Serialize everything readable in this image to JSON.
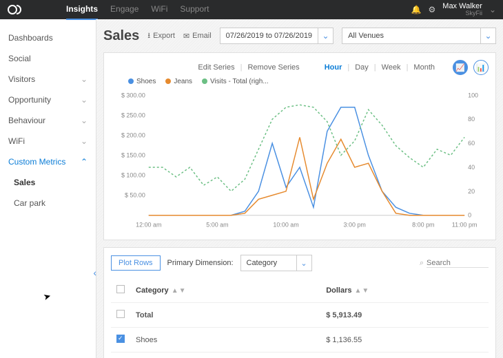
{
  "top": {
    "nav": [
      "Insights",
      "Engage",
      "WiFi",
      "Support"
    ],
    "active_index": 0,
    "user_name": "Max Walker",
    "user_org": "SkyFii"
  },
  "sidebar": {
    "items": [
      {
        "label": "Dashboards",
        "expandable": false
      },
      {
        "label": "Social",
        "expandable": false
      },
      {
        "label": "Visitors",
        "expandable": true
      },
      {
        "label": "Opportunity",
        "expandable": true
      },
      {
        "label": "Behaviour",
        "expandable": true
      },
      {
        "label": "WiFi",
        "expandable": true
      },
      {
        "label": "Custom Metrics",
        "expandable": true,
        "expanded": true,
        "active": true
      }
    ],
    "children": [
      {
        "label": "Sales",
        "active": true
      },
      {
        "label": "Car park",
        "active": false
      }
    ]
  },
  "page": {
    "title": "Sales",
    "export": "Export",
    "email": "Email",
    "date_range": "07/26/2019 to 07/26/2019",
    "venue": "All Venues"
  },
  "chart_controls": {
    "edit": "Edit Series",
    "remove": "Remove Series",
    "granularity": [
      "Hour",
      "Day",
      "Week",
      "Month"
    ],
    "active_granularity": 0,
    "legend": [
      {
        "name": "Shoes",
        "color": "#4a90e2"
      },
      {
        "name": "Jeans",
        "color": "#e68a2e"
      },
      {
        "name": "Visits - Total (righ...",
        "color": "#6cbf84"
      }
    ]
  },
  "chart_data": {
    "type": "line",
    "x": [
      0,
      1,
      2,
      3,
      4,
      5,
      6,
      7,
      8,
      9,
      10,
      11,
      12,
      13,
      14,
      15,
      16,
      17,
      18,
      19,
      20,
      21,
      22,
      23
    ],
    "x_ticks": [
      "12:00 am",
      "5:00 am",
      "10:00 am",
      "3:00 pm",
      "8:00 pm",
      "11:00 pm"
    ],
    "x_tick_positions": [
      0,
      5,
      10,
      15,
      20,
      23
    ],
    "y_left": {
      "min": 0,
      "max": 300,
      "step": 50,
      "label": "$",
      "ticks": [
        "$ 50.00",
        "$ 100.00",
        "$ 150.00",
        "$ 200.00",
        "$ 250.00",
        "$ 300.00"
      ]
    },
    "y_right": {
      "min": 0,
      "max": 100,
      "step": 20,
      "ticks": [
        "0",
        "20",
        "40",
        "60",
        "80",
        "100"
      ]
    },
    "series": [
      {
        "name": "Shoes",
        "axis": "left",
        "color": "#4a90e2",
        "style": "solid",
        "values": [
          0,
          0,
          0,
          0,
          0,
          0,
          0,
          10,
          60,
          180,
          70,
          120,
          20,
          210,
          270,
          270,
          150,
          60,
          20,
          5,
          0,
          0,
          0,
          0
        ]
      },
      {
        "name": "Jeans",
        "axis": "left",
        "color": "#e68a2e",
        "style": "solid",
        "values": [
          0,
          0,
          0,
          0,
          0,
          0,
          0,
          5,
          40,
          50,
          60,
          195,
          40,
          130,
          190,
          120,
          130,
          60,
          5,
          0,
          0,
          0,
          0,
          0
        ]
      },
      {
        "name": "Visits - Total",
        "axis": "right",
        "color": "#6cbf84",
        "style": "dashed",
        "values": [
          40,
          40,
          32,
          40,
          25,
          32,
          20,
          30,
          55,
          80,
          90,
          92,
          90,
          78,
          50,
          62,
          88,
          75,
          58,
          48,
          40,
          55,
          50,
          65
        ]
      }
    ]
  },
  "table_controls": {
    "plot_rows": "Plot Rows",
    "dim_label": "Primary Dimension:",
    "dim_value": "Category",
    "search_placeholder": "Search"
  },
  "table": {
    "columns": [
      "Category",
      "Dollars"
    ],
    "rows": [
      {
        "checked": false,
        "category": "Total",
        "dollars": "$ 5,913.49",
        "bold": true
      },
      {
        "checked": true,
        "category": "Shoes",
        "dollars": "$ 1,136.55",
        "bold": false
      }
    ]
  }
}
